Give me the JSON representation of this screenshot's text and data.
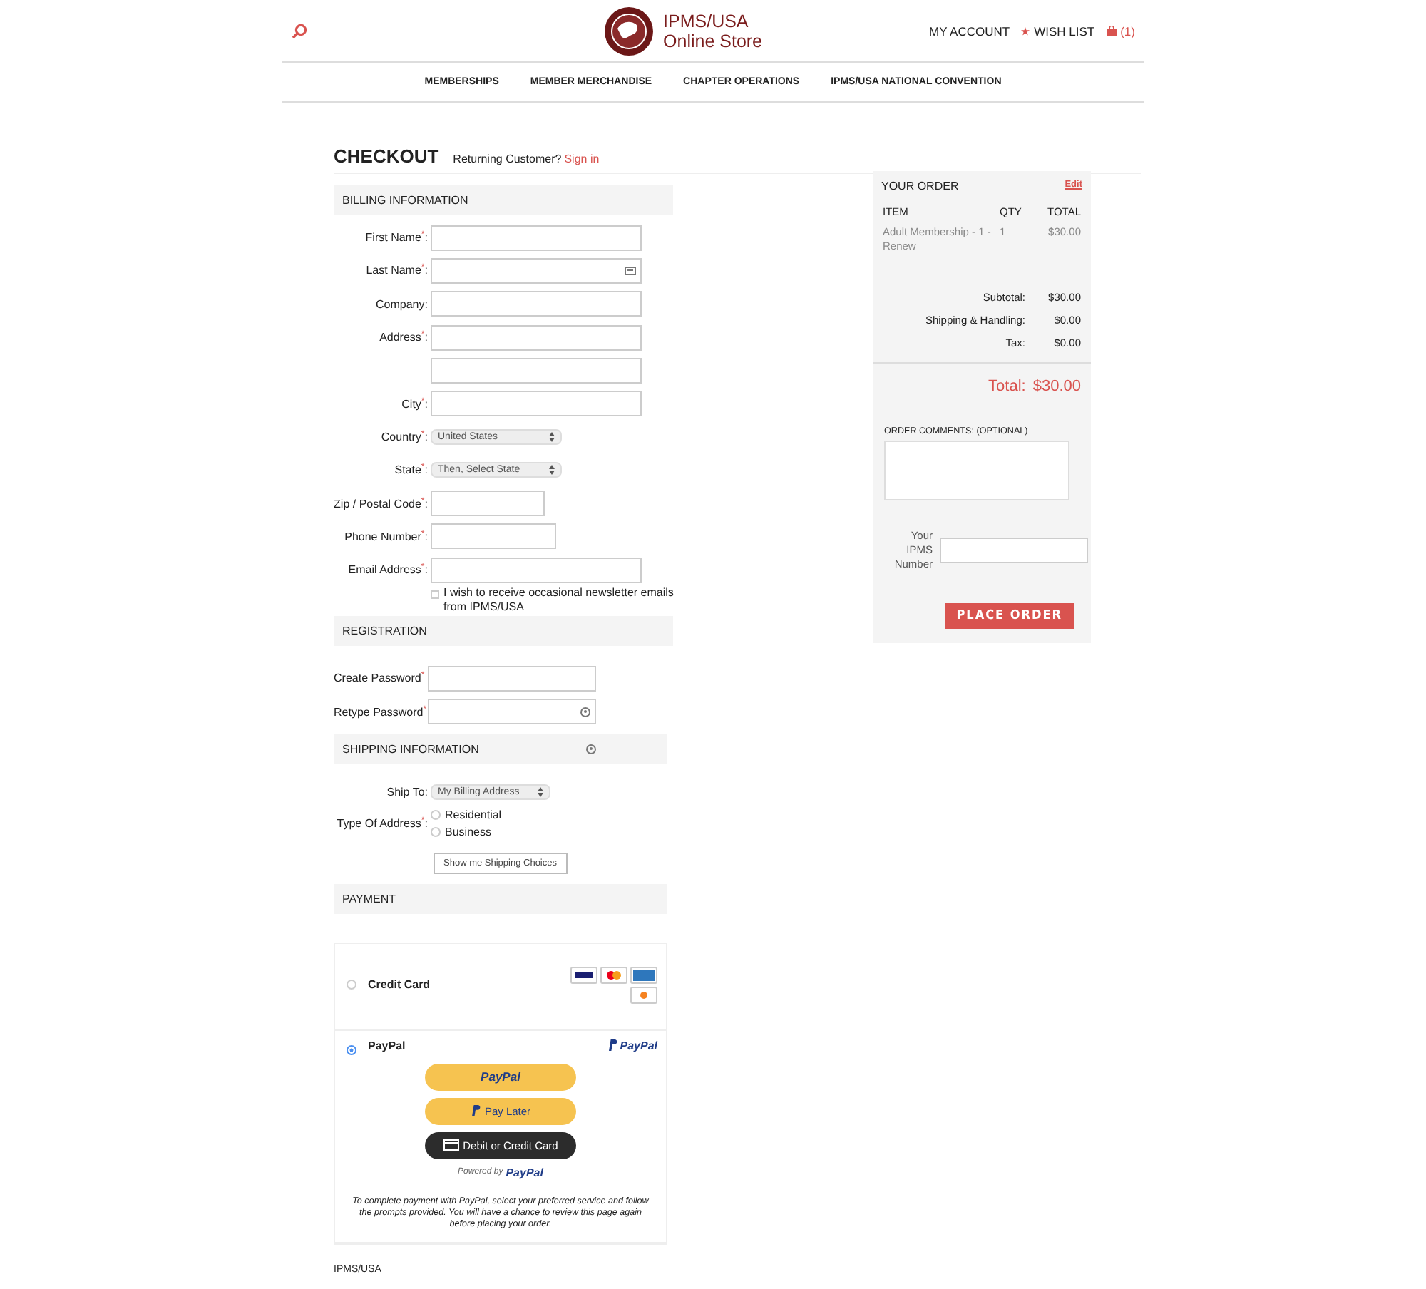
{
  "header": {
    "logo_line_1": "IPMS/USA",
    "logo_line_2": "Online Store",
    "account": "MY ACCOUNT",
    "wishlist": "WISH LIST",
    "cart_count": "(1)"
  },
  "nav": [
    {
      "label": "MEMBERSHIPS"
    },
    {
      "label": "MEMBER MERCHANDISE"
    },
    {
      "label": "CHAPTER OPERATIONS"
    },
    {
      "label": "IPMS/USA NATIONAL CONVENTION"
    }
  ],
  "checkout": {
    "title": "CHECKOUT",
    "returning": "Returning Customer?",
    "sign_in": "Sign in"
  },
  "billing": {
    "title": "BILLING INFORMATION",
    "fields": [
      {
        "kind": "text",
        "label": "First Name",
        "mark": "*",
        "suffix": ":"
      },
      {
        "kind": "card-text",
        "label": "Last Name",
        "mark": "*",
        "suffix": ":"
      },
      {
        "kind": "text",
        "label": "Company",
        "suffix": ":"
      },
      {
        "kind": "text",
        "label": "Address",
        "mark": "*",
        "suffix": ":"
      },
      {
        "kind": "text"
      },
      {
        "kind": "text",
        "label": "City",
        "mark": "*",
        "suffix": ":"
      },
      {
        "kind": "select",
        "label": "Country",
        "mark": "*",
        "suffix": ":",
        "value": "United States"
      },
      {
        "kind": "select",
        "label": "State",
        "mark": "*",
        "suffix": ":",
        "value": "Then, Select State"
      },
      {
        "kind": "short",
        "label": "Zip / Postal Code",
        "mark": "*",
        "suffix": ":"
      },
      {
        "kind": "medium",
        "label": "Phone Number",
        "mark": "*",
        "suffix": ":"
      },
      {
        "kind": "text",
        "label": "Email Address",
        "mark": "*",
        "suffix": ":"
      }
    ],
    "newsletter": {
      "label": "I wish to receive occasional newsletter emails from IPMS/USA",
      "checked": false
    }
  },
  "registration": {
    "title": "REGISTRATION",
    "fields": [
      {
        "kind": "text",
        "label": "Create Password",
        "mark": "*"
      },
      {
        "kind": "key-text",
        "label": "Retype Password",
        "mark": "*"
      }
    ]
  },
  "shipping": {
    "title": "SHIPPING INFORMATION",
    "ship_to_label": "Ship To:",
    "ship_to": "My Billing Address",
    "type_label": "Type Of Address",
    "type_mark": "*",
    "type_suffix": ":",
    "types": [
      {
        "label": "Residential",
        "selected": false
      },
      {
        "label": "Business",
        "selected": false
      }
    ],
    "button": "Show me Shipping Choices"
  },
  "payment": {
    "title": "PAYMENT",
    "methods": [
      {
        "kind": "card",
        "label": "Credit Card",
        "selected": false
      },
      {
        "kind": "paypal",
        "label": "PayPal",
        "selected": true,
        "brand": "PayPal"
      }
    ],
    "paypal_button": "PayPal",
    "pay_later": "Pay Later",
    "debit": "Debit or Credit Card",
    "powered": "Powered by",
    "powered_brand": "PayPal",
    "note": "To complete payment with PayPal, select your preferred service and follow the prompts provided. You will have a chance to review this page again before placing your order."
  },
  "order": {
    "title": "YOUR ORDER",
    "edit": "Edit",
    "columns": [
      "ITEM",
      "QTY",
      "TOTAL"
    ],
    "items": [
      {
        "name": "Adult Membership - 1 - Renew",
        "qty": "1",
        "total": "$30.00"
      }
    ],
    "summary": [
      {
        "label": "Subtotal:",
        "value": "$30.00"
      },
      {
        "label": "Shipping & Handling:",
        "value": "$0.00"
      },
      {
        "label": "Tax:",
        "value": "$0.00"
      }
    ],
    "total_label": "Total:",
    "total": "$30.00",
    "comments_label": "ORDER COMMENTS:  (OPTIONAL)",
    "ipms_label": "Your IPMS Number",
    "place_order": "PLACE ORDER"
  },
  "footer": {
    "text": "IPMS/USA"
  }
}
